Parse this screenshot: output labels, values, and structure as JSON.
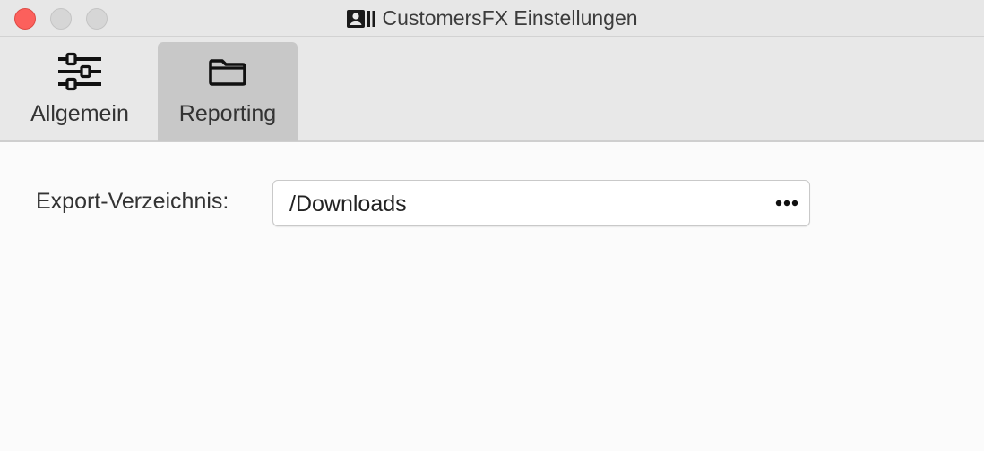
{
  "window": {
    "title": "CustomersFX Einstellungen",
    "title_icon": "contact-card-icon"
  },
  "traffic_lights": {
    "close_color": "#fc605c",
    "minimize_color": "#d6d6d6",
    "zoom_color": "#d6d6d6"
  },
  "toolbar": {
    "tabs": [
      {
        "label": "Allgemein",
        "icon": "sliders-icon",
        "selected": false
      },
      {
        "label": "Reporting",
        "icon": "folder-icon",
        "selected": true
      }
    ]
  },
  "reporting": {
    "export_dir_label": "Export-Verzeichnis:",
    "export_dir_value": "/Downloads",
    "browse_icon": "ellipsis-icon"
  }
}
